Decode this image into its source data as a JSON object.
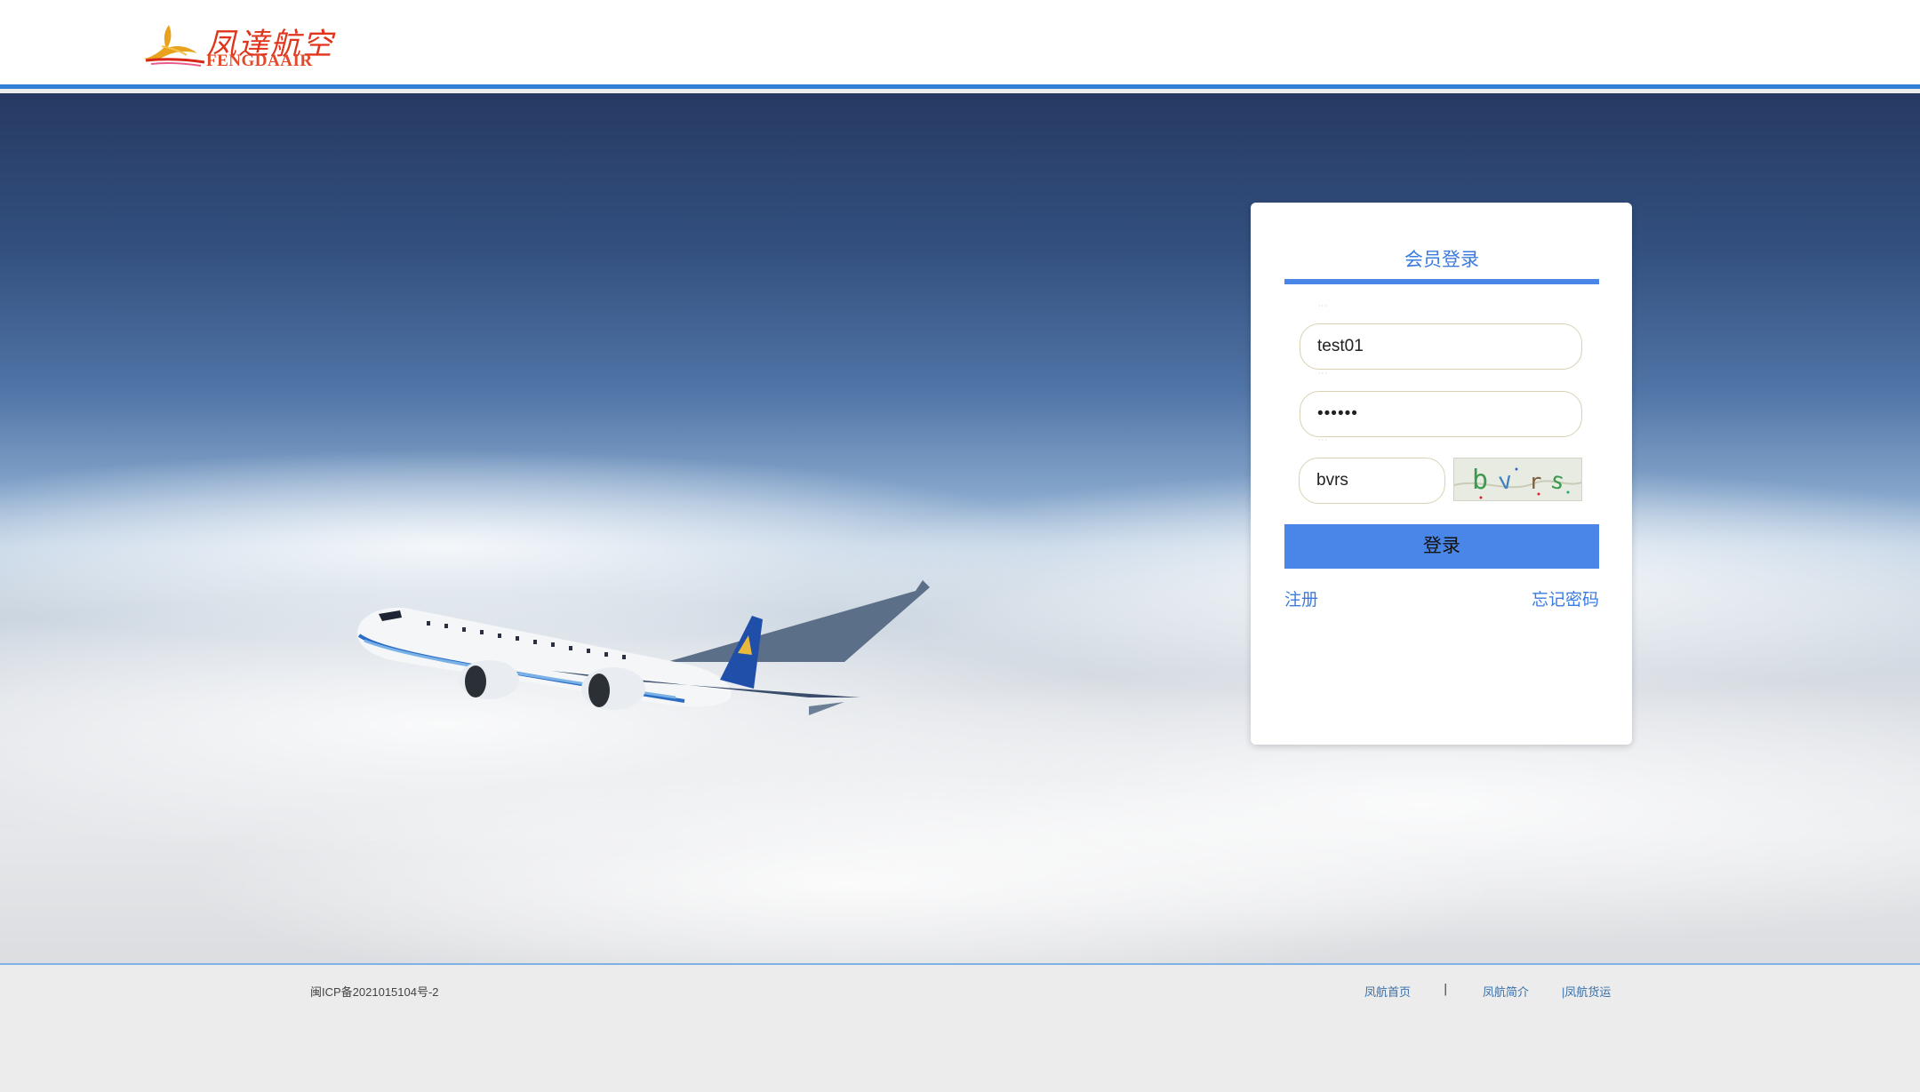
{
  "header": {
    "logo": {
      "cn_text": "凤達航空",
      "en_text": "FENGDAAIR"
    }
  },
  "login": {
    "title": "会员登录",
    "username_value": "test01",
    "password_value": "••••••",
    "captcha_input_value": "bvrs",
    "captcha_image_text": "bvrs",
    "submit_label": "登录",
    "register_label": "注册",
    "forgot_label": "忘记密码"
  },
  "footer": {
    "icp": "闽ICP备2021015104号-2",
    "links": [
      "凤航首页",
      "凤航简介",
      "|凤航货运"
    ],
    "separator": "|"
  },
  "colors": {
    "accent": "#4a86e8",
    "header_border": "#2f7fd6",
    "logo_red": "#e0341d"
  }
}
